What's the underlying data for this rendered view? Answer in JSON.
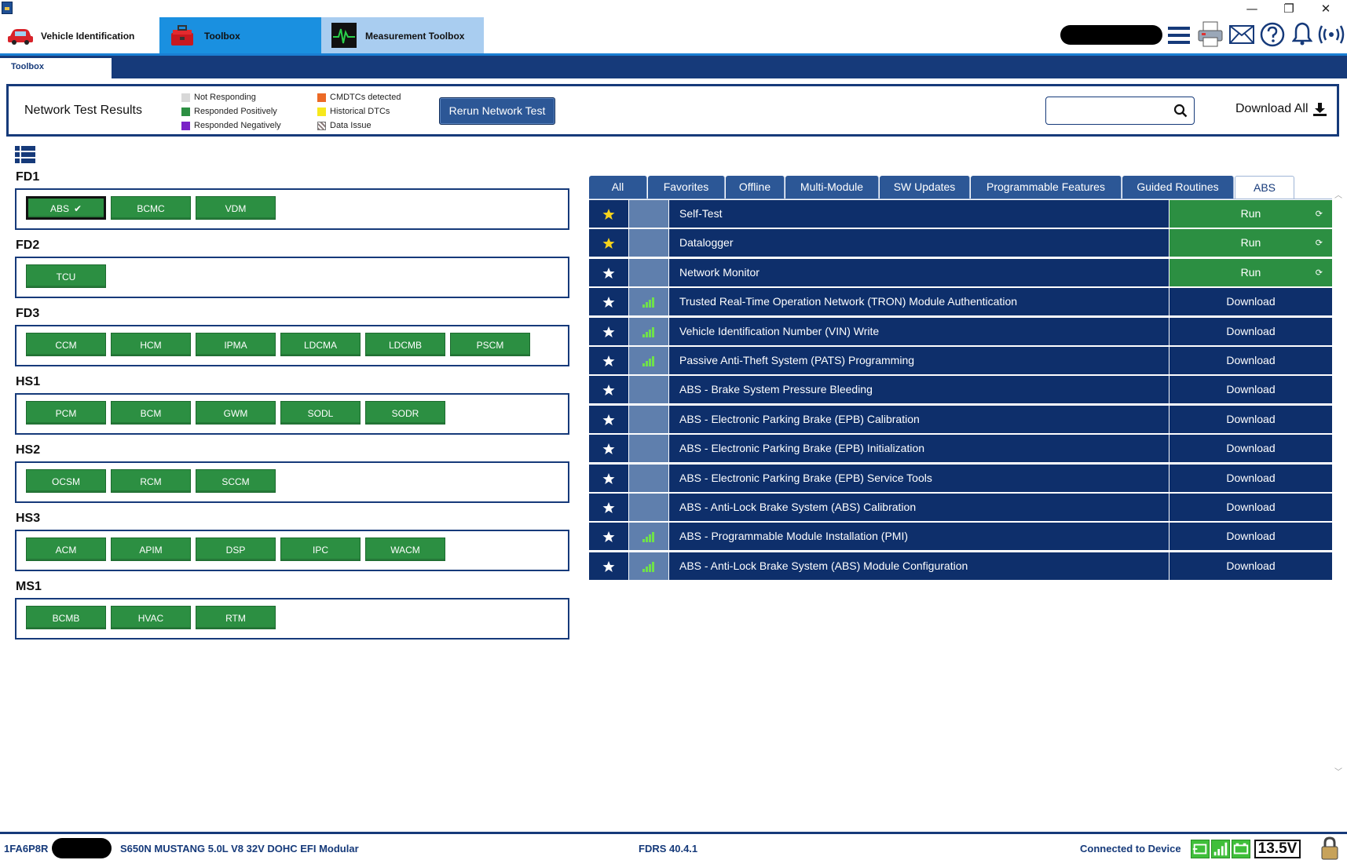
{
  "window": {
    "minimize_glyph": "—",
    "restore_glyph": "❐",
    "close_glyph": "✕"
  },
  "main_tabs": [
    {
      "label": "Vehicle Identification",
      "icon": "car-icon"
    },
    {
      "label": "Toolbox",
      "icon": "toolbox-icon"
    },
    {
      "label": "Measurement Toolbox",
      "icon": "oscilloscope-icon"
    }
  ],
  "sub_tab": {
    "label": "Toolbox"
  },
  "network_test": {
    "title": "Network Test Results",
    "legend": [
      {
        "label": "Not Responding",
        "color": "#d8d8d8"
      },
      {
        "label": "Responded Positively",
        "color": "#2c8f42"
      },
      {
        "label": "Responded Negatively",
        "color": "#7a22c7"
      },
      {
        "label": "CMDTCs detected",
        "color": "#ec6a26"
      },
      {
        "label": "Historical DTCs",
        "color": "#f7e81d"
      },
      {
        "label": "Data Issue",
        "color": "#8a7a7a"
      }
    ],
    "rerun_label": "Rerun Network Test",
    "search_value": "",
    "download_all_label": "Download All"
  },
  "buses": [
    {
      "name": "FD1",
      "modules": [
        "ABS",
        "BCMC",
        "VDM"
      ],
      "selected": "ABS"
    },
    {
      "name": "FD2",
      "modules": [
        "TCU"
      ]
    },
    {
      "name": "FD3",
      "modules": [
        "CCM",
        "HCM",
        "IPMA",
        "LDCMA",
        "LDCMB",
        "PSCM"
      ]
    },
    {
      "name": "HS1",
      "modules": [
        "PCM",
        "BCM",
        "GWM",
        "SODL",
        "SODR"
      ]
    },
    {
      "name": "HS2",
      "modules": [
        "OCSM",
        "RCM",
        "SCCM"
      ]
    },
    {
      "name": "HS3",
      "modules": [
        "ACM",
        "APIM",
        "DSP",
        "IPC",
        "WACM"
      ]
    },
    {
      "name": "MS1",
      "modules": [
        "BCMB",
        "HVAC",
        "RTM"
      ]
    }
  ],
  "selected_check": "✔",
  "routine_tabs": [
    {
      "label": "All"
    },
    {
      "label": "Favorites"
    },
    {
      "label": "Offline"
    },
    {
      "label": "Multi-Module"
    },
    {
      "label": "SW Updates"
    },
    {
      "label": "Programmable Features"
    },
    {
      "label": "Guided Routines"
    },
    {
      "label": "ABS",
      "active": true
    }
  ],
  "routines": [
    {
      "name": "Self-Test",
      "action": "Run",
      "favorite": true,
      "signal": false
    },
    {
      "name": "Datalogger",
      "action": "Run",
      "favorite": true,
      "signal": false
    },
    {
      "name": "Network Monitor",
      "action": "Run",
      "favorite": false,
      "signal": false
    },
    {
      "name": "Trusted Real-Time Operation Network (TRON) Module Authentication",
      "action": "Download",
      "favorite": false,
      "signal": true
    },
    {
      "name": "Vehicle Identification Number (VIN) Write",
      "action": "Download",
      "favorite": false,
      "signal": true
    },
    {
      "name": "Passive Anti-Theft System (PATS) Programming",
      "action": "Download",
      "favorite": false,
      "signal": true
    },
    {
      "name": "ABS - Brake System Pressure Bleeding",
      "action": "Download",
      "favorite": false,
      "signal": false
    },
    {
      "name": "ABS - Electronic Parking Brake (EPB) Calibration",
      "action": "Download",
      "favorite": false,
      "signal": false
    },
    {
      "name": "ABS - Electronic Parking Brake (EPB) Initialization",
      "action": "Download",
      "favorite": false,
      "signal": false
    },
    {
      "name": "ABS - Electronic Parking Brake (EPB) Service Tools",
      "action": "Download",
      "favorite": false,
      "signal": false
    },
    {
      "name": "ABS - Anti-Lock Brake System (ABS) Calibration",
      "action": "Download",
      "favorite": false,
      "signal": false
    },
    {
      "name": "ABS - Programmable Module Installation (PMI)",
      "action": "Download",
      "favorite": false,
      "signal": true
    },
    {
      "name": "ABS - Anti-Lock Brake System (ABS) Module Configuration",
      "action": "Download",
      "favorite": false,
      "signal": true
    }
  ],
  "status": {
    "vin_prefix": "1FA6P8R",
    "vehicle": "S650N MUSTANG 5.0L V8 32V DOHC EFI Modular",
    "version": "FDRS 40.4.1",
    "connection": "Connected to Device",
    "voltage": "13.5V"
  },
  "colors": {
    "accent_blue": "#163a7a",
    "module_green": "#2c8f42",
    "row_navy": "#0e2f6b",
    "star_yellow": "#f5d31c"
  }
}
